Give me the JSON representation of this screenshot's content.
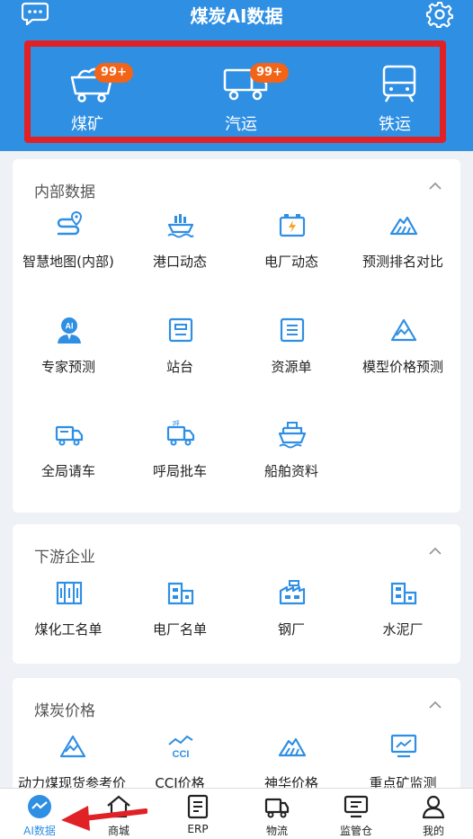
{
  "app": {
    "title": "煤炭AI数据"
  },
  "transport": [
    {
      "label": "煤矿",
      "badge": "99+"
    },
    {
      "label": "汽运",
      "badge": "99+"
    },
    {
      "label": "铁运"
    }
  ],
  "sections": {
    "internal": {
      "title": "内部数据",
      "items": [
        "智慧地图(内部)",
        "港口动态",
        "电厂动态",
        "预测排名对比",
        "专家预测",
        "站台",
        "资源单",
        "模型价格预测",
        "全局请车",
        "呼局批车",
        "船舶资料"
      ]
    },
    "downstream": {
      "title": "下游企业",
      "items": [
        "煤化工名单",
        "电厂名单",
        "钢厂",
        "水泥厂"
      ]
    },
    "price": {
      "title": "煤炭价格",
      "items": [
        "动力煤现货参考价",
        "CCI价格",
        "神华价格",
        "重点矿监测"
      ]
    }
  },
  "icons": {
    "cci_text": "CCI",
    "hu_text": "呼",
    "ai_text": "AI"
  },
  "tabs": [
    "AI数据",
    "商城",
    "ERP",
    "物流",
    "监管仓",
    "我的"
  ],
  "colors": {
    "primary": "#2f8fe3",
    "badge": "#f26418",
    "highlight": "#e02226"
  }
}
